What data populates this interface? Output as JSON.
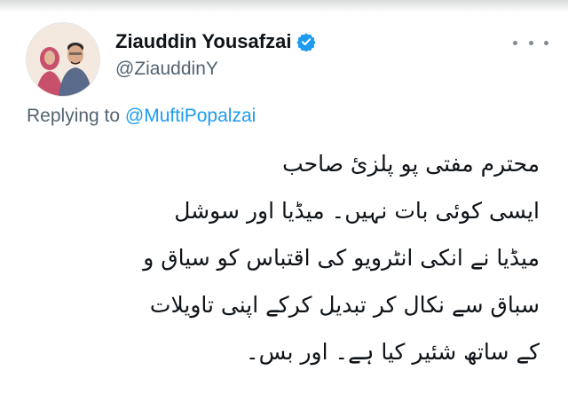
{
  "author": {
    "name": "Ziauddin Yousafzai",
    "handle": "@ZiauddinY",
    "avatar_icon": "profile-photo-avatar",
    "verified_icon": "verified-badge-icon"
  },
  "reply": {
    "prefix": "Replying to",
    "mention": "@MuftiPopalzai"
  },
  "tweet": {
    "lines": [
      "محترم مفتی پو پلزئ صاحب",
      "ایسی کوئی بات نہیں۔ میڈیا اور سوشل",
      "میڈیا نے انکی انٹرویو کی اقتباس کو سیاق و",
      "سباق سے نکال کر تبدیل کرکے اپنی تاویلات",
      "کے ساتھ شئیر کیا ہے۔ اور بس۔"
    ]
  },
  "more_icon": "more-options-icon",
  "colors": {
    "text": "#0f1419",
    "secondary": "#536471",
    "accent": "#1d9bf0"
  }
}
